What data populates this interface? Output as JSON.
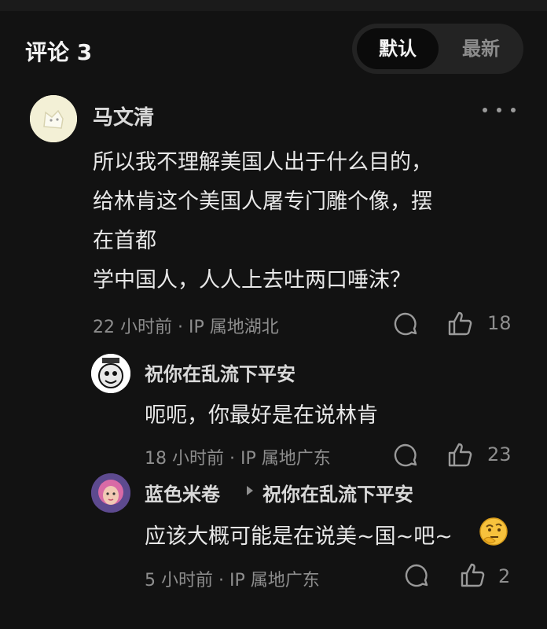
{
  "header": {
    "title": "评论 3",
    "tabs": [
      {
        "label": "默认",
        "active": true
      },
      {
        "label": "最新",
        "active": false
      }
    ]
  },
  "comments": [
    {
      "author": "马文清",
      "lines": [
        "所以我不理解美国人出于什么目的，",
        "给林肯这个美国人屠专门雕个像，摆",
        "在首都",
        "学中国人，人人上去吐两口唾沫？"
      ],
      "time": "22 小时前 · IP 属地湖北",
      "likes": "18",
      "more_icon": "more-dots-icon"
    }
  ],
  "replies": [
    {
      "author": "祝你在乱流下平安",
      "text": "呃呃，你最好是在说林肯",
      "time": "18 小时前 · IP 属地广东",
      "likes": "23"
    },
    {
      "author": "蓝色米卷",
      "reply_to": "祝你在乱流下平安",
      "text": "应该大概可能是在说美~国~吧~",
      "emoji": "thinking-face",
      "time": "5 小时前 · IP 属地广东",
      "likes": "2"
    }
  ],
  "icons": {
    "reply": "comment-bubble-icon",
    "like": "thumbs-up-icon"
  },
  "colors": {
    "background": "#121212",
    "text": "#e8e8e8",
    "muted": "#8e8e8e"
  }
}
